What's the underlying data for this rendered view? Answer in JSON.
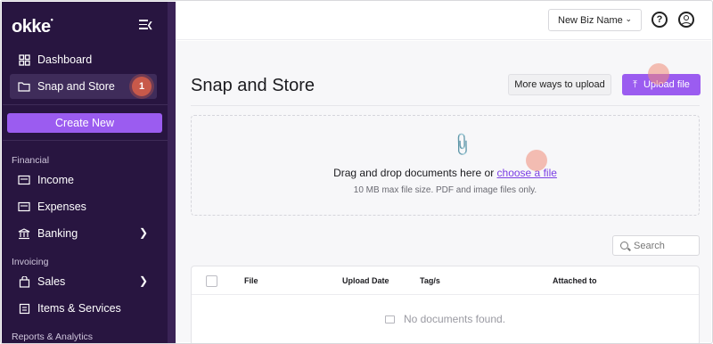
{
  "sidebar": {
    "logo": "okke",
    "logo_mark": "•",
    "items": [
      {
        "label": "Dashboard",
        "icon": "grid-icon"
      },
      {
        "label": "Snap and Store",
        "icon": "folder-icon",
        "badge": "1"
      }
    ],
    "create_label": "Create New",
    "financial_label": "Financial",
    "financial_items": [
      {
        "label": "Income",
        "icon": "receipt-icon"
      },
      {
        "label": "Expenses",
        "icon": "receipt-icon"
      },
      {
        "label": "Banking",
        "icon": "bank-icon"
      }
    ],
    "invoicing_label": "Invoicing",
    "invoicing_items": [
      {
        "label": "Sales",
        "icon": "bag-icon"
      },
      {
        "label": "Items & Services",
        "icon": "list-icon"
      }
    ],
    "reports_label": "Reports & Analytics"
  },
  "header": {
    "business_name": "New Biz Name",
    "help_glyph": "?"
  },
  "main": {
    "title": "Snap and Store",
    "more_ways_label": "More ways to upload",
    "upload_label": "Upload file",
    "drop_text": "Drag and drop documents here or ",
    "drop_link": "choose a file",
    "drop_sub": "10 MB max file size. PDF and image files only.",
    "search_placeholder": "Search",
    "table_columns": [
      "File",
      "Upload Date",
      "Tag/s",
      "Attached to"
    ],
    "empty_text": "No documents found."
  },
  "colors": {
    "sidebar_bg": "#281540",
    "accent": "#9b5cf0",
    "badge": "#c8594a"
  }
}
